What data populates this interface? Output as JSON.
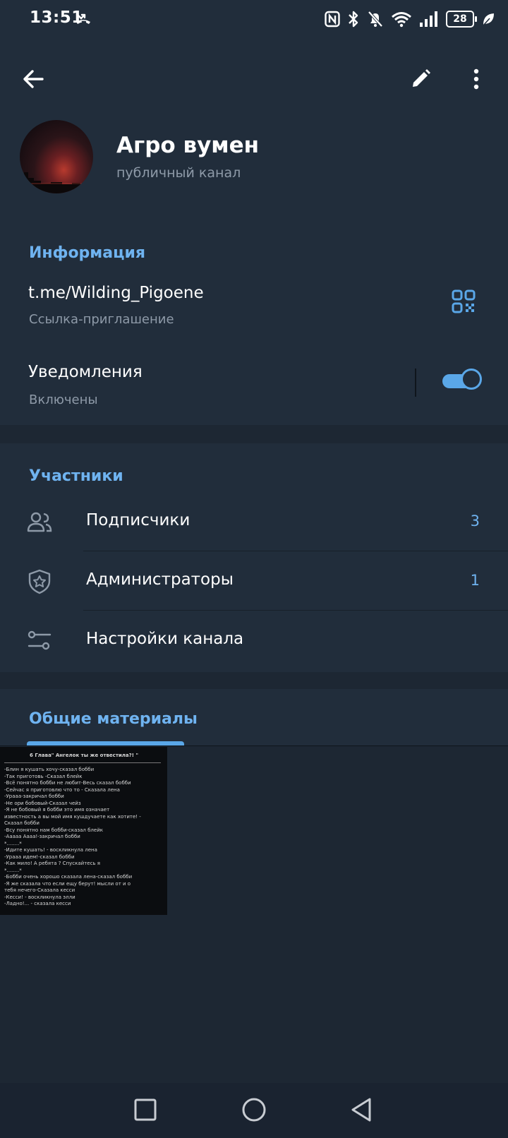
{
  "status_bar": {
    "time": "13:51",
    "battery": "28",
    "icons": [
      "missed-call-icon",
      "nfc-icon",
      "bluetooth-icon",
      "mute-icon",
      "wifi-icon",
      "signal-icon",
      "battery-icon",
      "leaf-icon"
    ]
  },
  "header": {
    "channel_name": "Агро вумен",
    "channel_type": "публичный канал"
  },
  "info": {
    "section_title": "Информация",
    "link": "t.me/Wilding_Pigoene",
    "link_caption": "Ссылка-приглашение",
    "notifications_label": "Уведомления",
    "notifications_state": "Включены",
    "notifications_enabled": true
  },
  "members": {
    "section_title": "Участники",
    "items": [
      {
        "label": "Подписчики",
        "count": "3",
        "icon": "people-icon"
      },
      {
        "label": "Администраторы",
        "count": "1",
        "icon": "admin-shield-icon"
      },
      {
        "label": "Настройки канала",
        "count": "",
        "icon": "settings-sliders-icon"
      }
    ]
  },
  "shared": {
    "tab_label": "Общие материалы",
    "thumb_title": "6 Глава\" Ангелок ты же отвестила?! \"",
    "thumb_text": "-Блин я кушать хочу-сказал бобби\n-Так приготовь -Сказал блейк\n-Всё понятно бобби не любит-Весь сказал бобби\n-Сейчас я приготовлю что то - Сказала лена\n-Урааа-закричал бобби\n-Не ори бобовый-Сказал чейз\n-Я не бобовый я бобби это имя означает\nизвестность а вы мой имя кушдучаете как хотите! -\nСказал бобби\n-Всу понятно нам бобби-сказал блейк\n-Ааааа Аааа!-закричал бобби\n*........*\n-Идите кушать! - воскликнула лена\n-Урааа идем!-сказал бобби\n-Как мило! А ребята ? Спускайтесь я\n*........*\n-Бобби очень хорошо сказала лена-сказал бобби\n-Я же сказала что если ещу берут! мысли от и о\nтебя нечего-Сказала кесси\n-Кесси! - воскликнула элли\n-Ладно!... - сказала кесси"
  },
  "accent_color": "#6fb3f0",
  "background_color": "#1d2733",
  "card_color": "#212d3b"
}
